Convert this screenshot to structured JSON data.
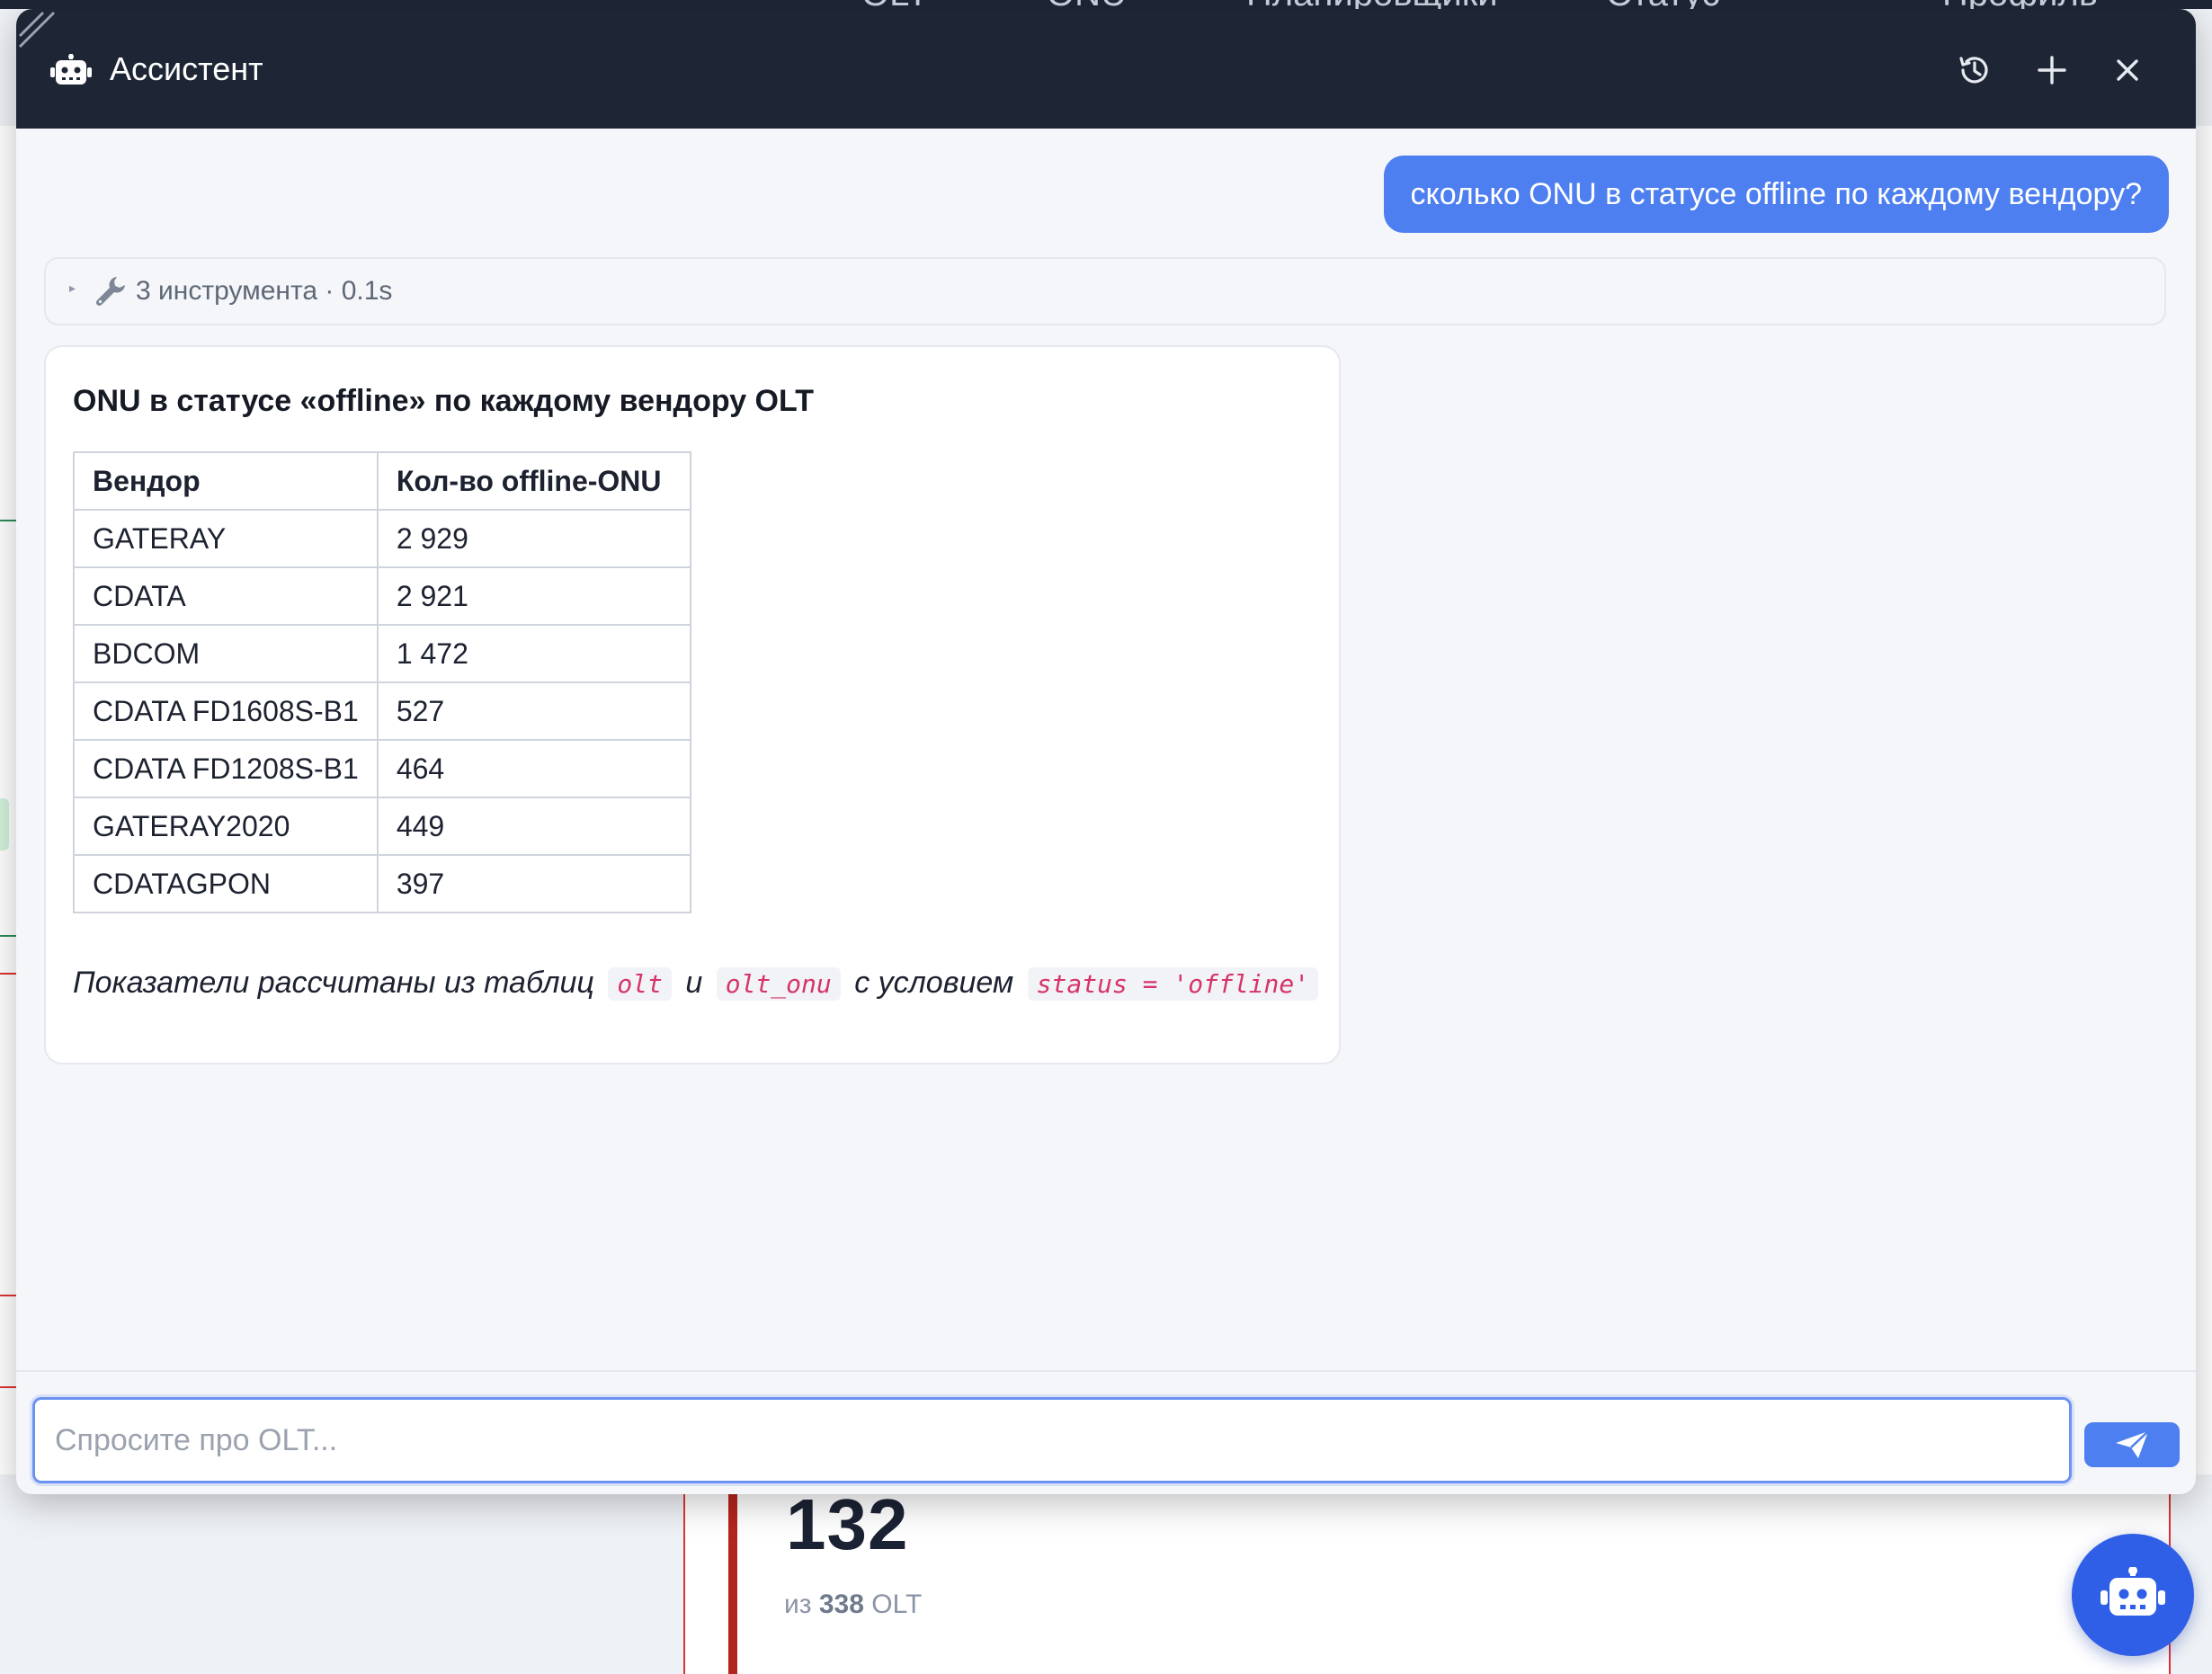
{
  "background": {
    "nav_items": [
      {
        "label": "OLT"
      },
      {
        "label": "ONU"
      },
      {
        "label": "Планировщики"
      },
      {
        "label": "Статус"
      },
      {
        "label": "Профиль"
      }
    ],
    "card": {
      "value": "132",
      "sub_prefix": "из",
      "sub_value": "338",
      "sub_suffix": "OLT"
    }
  },
  "modal": {
    "title": "Ассистент",
    "header_icons": [
      "history-icon",
      "plus-icon",
      "close-icon"
    ]
  },
  "chat": {
    "user_message": "сколько ONU в статусе offline по каждому вендору?",
    "tools_summary": "3 инструмента · 0.1s",
    "answer": {
      "title": "ONU в статусе «offline» по каждому вендору OLT",
      "table": {
        "headers": [
          "Вендор",
          "Кол-во offline-ONU"
        ],
        "rows": [
          [
            "GATERAY",
            "2 929"
          ],
          [
            "CDATA",
            "2 921"
          ],
          [
            "BDCOM",
            "1 472"
          ],
          [
            "CDATA FD1608S-B1",
            "527"
          ],
          [
            "CDATA FD1208S-B1",
            "464"
          ],
          [
            "GATERAY2020",
            "449"
          ],
          [
            "CDATAGPON",
            "397"
          ]
        ]
      },
      "note": {
        "prefix": "Показатели рассчитаны из таблиц",
        "code1": "olt",
        "join": "и",
        "code2": "olt_onu",
        "middle": "с условием",
        "code3": "status = 'offline'"
      }
    }
  },
  "input": {
    "placeholder": "Спросите про OLT..."
  },
  "colors": {
    "header_bg": "#1e2636",
    "accent": "#4d7ff0",
    "fab": "#2f5fe6",
    "code": "#d6336c"
  }
}
